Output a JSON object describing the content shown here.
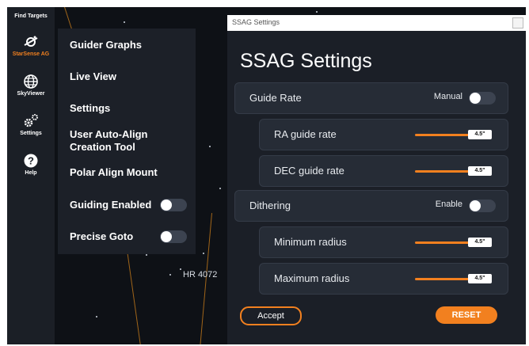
{
  "rail": {
    "items": [
      {
        "label": "Find Targets",
        "icon": "find-targets-icon"
      },
      {
        "label": "StarSense AG",
        "icon": "starsense-icon",
        "active": true
      },
      {
        "label": "SkyViewer",
        "icon": "globe-icon"
      },
      {
        "label": "Settings",
        "icon": "gears-icon"
      },
      {
        "label": "Help",
        "icon": "help-icon"
      }
    ]
  },
  "menu": {
    "items": [
      {
        "label": "Guider Graphs"
      },
      {
        "label": "Live View"
      },
      {
        "label": "Settings"
      },
      {
        "label_line1": "User Auto-Align",
        "label_line2": "Creation Tool"
      },
      {
        "label": "Polar Align Mount"
      },
      {
        "label": "Guiding Enabled",
        "toggle": "off"
      },
      {
        "label": "Precise Goto",
        "toggle": "off"
      }
    ]
  },
  "sky": {
    "star_label": "HR 4072"
  },
  "dialog": {
    "window_title": "SSAG Settings",
    "heading": "SSAG Settings",
    "guide_rate": {
      "label": "Guide Rate",
      "mode": "Manual",
      "toggle": "off"
    },
    "ra_guide_rate": {
      "label": "RA guide rate",
      "value": "4.5\""
    },
    "dec_guide_rate": {
      "label": "DEC guide rate",
      "value": "4.5\""
    },
    "dithering": {
      "label": "Dithering",
      "mode": "Enable",
      "toggle": "off"
    },
    "minimum_radius": {
      "label": "Minimum radius",
      "value": "4.5\""
    },
    "maximum_radius": {
      "label": "Maximum radius",
      "value": "4.5\""
    },
    "accept_label": "Accept",
    "reset_label": "RESET"
  },
  "colors": {
    "accent": "#f2801f",
    "background": "#0e1116",
    "panel": "#1c2028",
    "row": "#262c36"
  }
}
